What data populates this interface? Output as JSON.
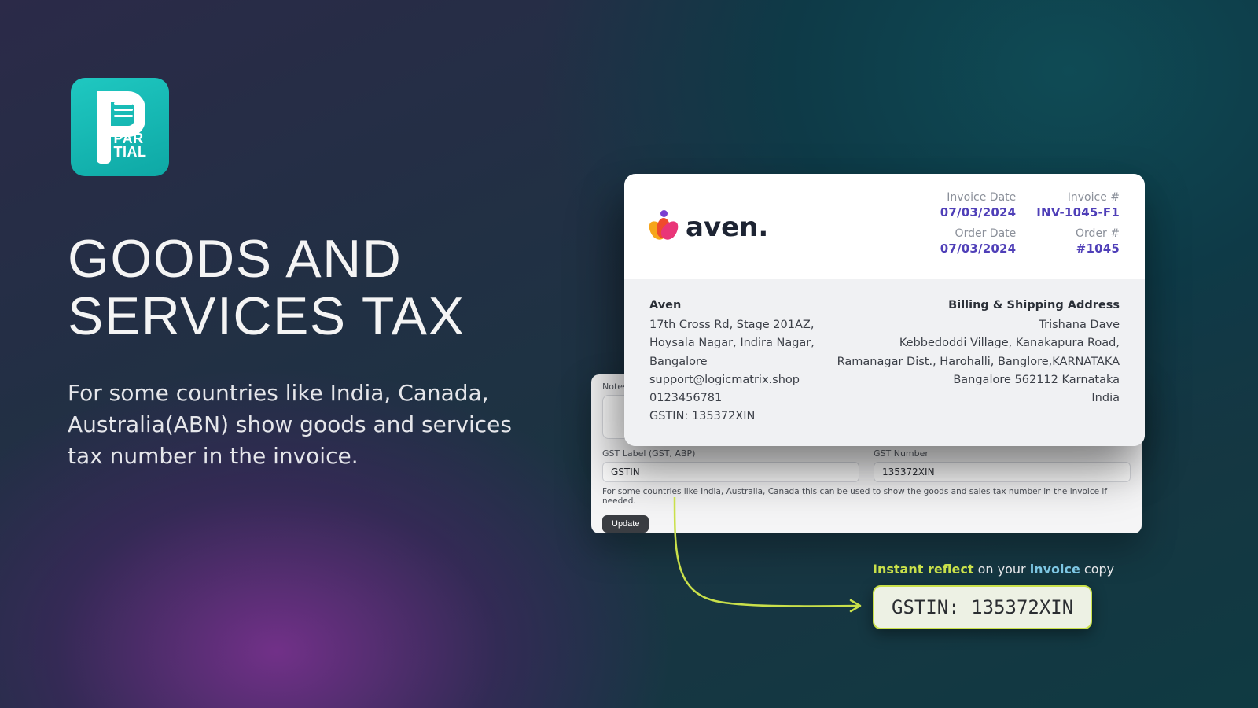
{
  "logo": {
    "line1": "PAR",
    "line2": "TIAL"
  },
  "headline": {
    "title_line1": "Goods and",
    "title_line2": "services tax",
    "subtitle": "For some countries like India, Canada, Australia(ABN) show goods and services tax number in the invoice."
  },
  "invoice": {
    "brand_name": "aven.",
    "meta": {
      "invoice_date_label": "Invoice Date",
      "invoice_date": "07/03/2024",
      "order_date_label": "Order Date",
      "order_date": "07/03/2024",
      "invoice_no_label": "Invoice #",
      "invoice_no": "INV-1045-F1",
      "order_no_label": "Order #",
      "order_no": "#1045"
    },
    "company": {
      "name": "Aven",
      "addr1": "17th Cross Rd, Stage 201AZ,",
      "addr2": "Hoysala Nagar, Indira Nagar,",
      "addr3": "Bangalore",
      "email": "support@logicmatrix.shop",
      "phone": "0123456781",
      "gstin": "GSTIN: 135372XIN"
    },
    "shipping": {
      "title": "Billing & Shipping Address",
      "name": "Trishana Dave",
      "addr1": "Kebbedoddi Village, Kanakapura Road,",
      "addr2": "Ramanagar Dist., Harohalli, Banglore,KARNATAKA",
      "addr3": "Bangalore 562112 Karnataka",
      "country": "India"
    }
  },
  "settings": {
    "notes_label": "Notes f",
    "gst_label_caption": "GST Label (GST, ABP)",
    "gst_label_value": "GSTIN",
    "gst_number_caption": "GST Number",
    "gst_number_value": "135372XIN",
    "helper": "For some countries like India, Australia, Canada this can be used to show the goods and sales tax number in the invoice if needed.",
    "update_label": "Update"
  },
  "callout": {
    "t1": "Instant reflect",
    "t2": " on your ",
    "t3": "invoice",
    "t4": " copy",
    "chip": "GSTIN: 135372XIN"
  }
}
